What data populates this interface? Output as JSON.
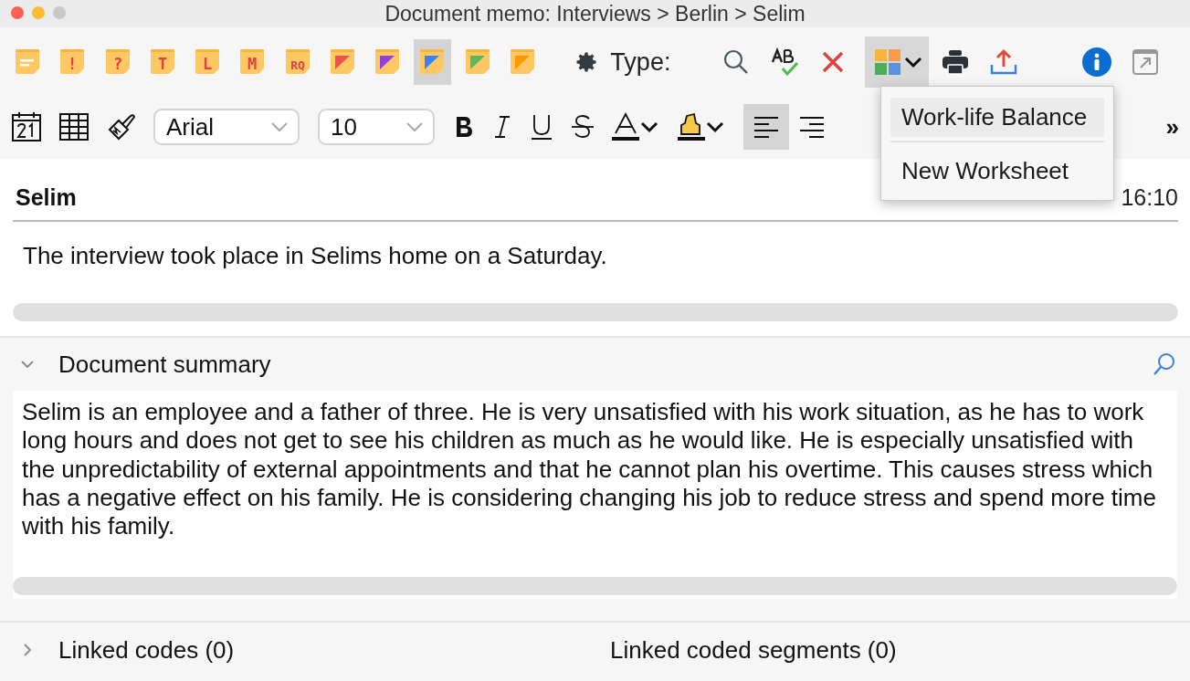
{
  "window": {
    "title": "Document memo: Interviews > Berlin > Selim"
  },
  "memo_types": [
    {
      "kind": "lines",
      "selected": false
    },
    {
      "kind": "letter",
      "glyph": "!",
      "selected": false
    },
    {
      "kind": "letter",
      "glyph": "?",
      "selected": false
    },
    {
      "kind": "letter",
      "glyph": "T",
      "selected": false
    },
    {
      "kind": "letter",
      "glyph": "L",
      "selected": false
    },
    {
      "kind": "letter",
      "glyph": "M",
      "selected": false
    },
    {
      "kind": "letter",
      "glyph": "RQ",
      "selected": false
    },
    {
      "kind": "corner",
      "color": "#ef5350",
      "selected": false
    },
    {
      "kind": "corner",
      "color": "#9140e0",
      "selected": false
    },
    {
      "kind": "corner",
      "color": "#3b82f6",
      "selected": true
    },
    {
      "kind": "corner",
      "color": "#5cb85c",
      "selected": false
    },
    {
      "kind": "corner",
      "color": "#ff9800",
      "selected": false
    }
  ],
  "type_label": "Type:",
  "font": {
    "family": "Arial",
    "size": "10"
  },
  "align_left_selected": true,
  "more": "»",
  "dropdown": {
    "items": [
      {
        "label": "Work-life Balance",
        "selected": true
      },
      {
        "label": "New Worksheet",
        "selected": false
      }
    ]
  },
  "memo": {
    "title": "Selim",
    "meta": "16:10",
    "text": "The interview took place in Selims home on a Saturday."
  },
  "summary": {
    "title": "Document summary",
    "expanded": true,
    "text": "Selim is an employee and a father of three. He is very unsatisfied with his work situation, as he has to work long hours and does not get to see his children as much as he would like. He is especially unsatisfied with the unpredictability of external appointments and that he cannot plan his overtime. This causes stress which has a negative effect on his family. He is considering changing his job to reduce stress and spend more time with his family."
  },
  "linked": {
    "codes": "Linked codes (0)",
    "segments": "Linked coded segments (0)",
    "expanded": false
  }
}
